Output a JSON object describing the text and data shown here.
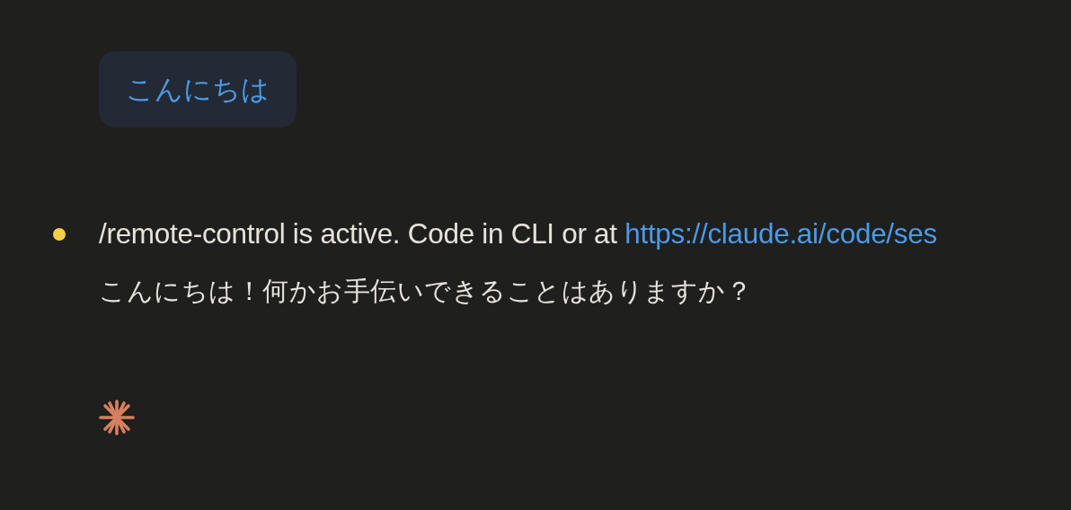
{
  "user_message": {
    "text": "こんにちは"
  },
  "response": {
    "status_text": "/remote-control is active. Code in CLI or at",
    "link": "https://claude.ai/code/ses",
    "reply": "こんにちは！何かお手伝いできることはありますか？"
  }
}
